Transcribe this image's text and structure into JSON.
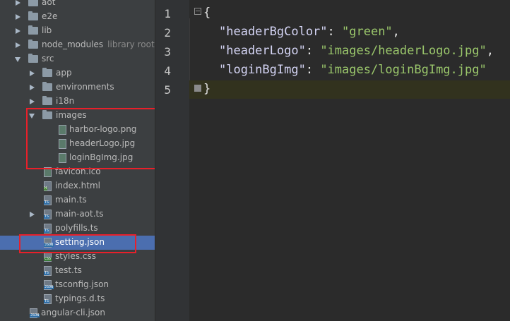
{
  "project_tree": {
    "items": [
      {
        "label": "aot",
        "hint": "",
        "icon": "folder-icon"
      },
      {
        "label": "e2e",
        "hint": "",
        "icon": "folder-icon"
      },
      {
        "label": "lib",
        "hint": "",
        "icon": "folder-icon"
      },
      {
        "label": "node_modules",
        "hint": "library root",
        "icon": "folder-icon"
      },
      {
        "label": "src",
        "hint": "",
        "icon": "folder-icon"
      },
      {
        "label": "app",
        "hint": "",
        "icon": "folder-icon"
      },
      {
        "label": "environments",
        "hint": "",
        "icon": "folder-icon"
      },
      {
        "label": "i18n",
        "hint": "",
        "icon": "folder-icon"
      },
      {
        "label": "images",
        "hint": "",
        "icon": "folder-icon"
      },
      {
        "label": "harbor-logo.png",
        "hint": "",
        "icon": "image-file-icon"
      },
      {
        "label": "headerLogo.jpg",
        "hint": "",
        "icon": "image-file-icon"
      },
      {
        "label": "loginBgImg.jpg",
        "hint": "",
        "icon": "image-file-icon"
      },
      {
        "label": "favicon.ico",
        "hint": "",
        "icon": "image-file-icon"
      },
      {
        "label": "index.html",
        "hint": "",
        "icon": "html-file-icon"
      },
      {
        "label": "main.ts",
        "hint": "",
        "icon": "ts-file-icon"
      },
      {
        "label": "main-aot.ts",
        "hint": "",
        "icon": "ts-file-icon"
      },
      {
        "label": "polyfills.ts",
        "hint": "",
        "icon": "ts-file-icon"
      },
      {
        "label": "setting.json",
        "hint": "",
        "icon": "json-file-icon"
      },
      {
        "label": "styles.css",
        "hint": "",
        "icon": "css-file-icon"
      },
      {
        "label": "test.ts",
        "hint": "",
        "icon": "ts-file-icon"
      },
      {
        "label": "tsconfig.json",
        "hint": "",
        "icon": "json-file-icon"
      },
      {
        "label": "typings.d.ts",
        "hint": "",
        "icon": "ts-file-icon"
      },
      {
        "label": "angular-cli.json",
        "hint": "",
        "icon": "json-file-icon"
      }
    ],
    "icon_tags": {
      "ts": "TS",
      "json": "JSON",
      "css": "CSS",
      "html": "H"
    }
  },
  "editor": {
    "line_numbers": [
      "1",
      "2",
      "3",
      "4",
      "5"
    ],
    "lines": [
      {
        "open": "{"
      },
      {
        "key": "\"headerBgColor\"",
        "sep": ": ",
        "value": "\"green\"",
        "end": ","
      },
      {
        "key": "\"headerLogo\"",
        "sep": ": ",
        "value": "\"images/headerLogo.jpg\"",
        "end": ","
      },
      {
        "key": "\"loginBgImg\"",
        "sep": ": ",
        "value": "\"images/loginBgImg.jpg\"",
        "end": ""
      },
      {
        "close": "}"
      }
    ]
  },
  "colors": {
    "sidebar_bg": "#3c3f41",
    "editor_bg": "#2b2b2b",
    "selection": "#4b6eaf",
    "highlight_box": "#e8202a",
    "string": "#9ac66b",
    "current_line": "#32321e"
  }
}
